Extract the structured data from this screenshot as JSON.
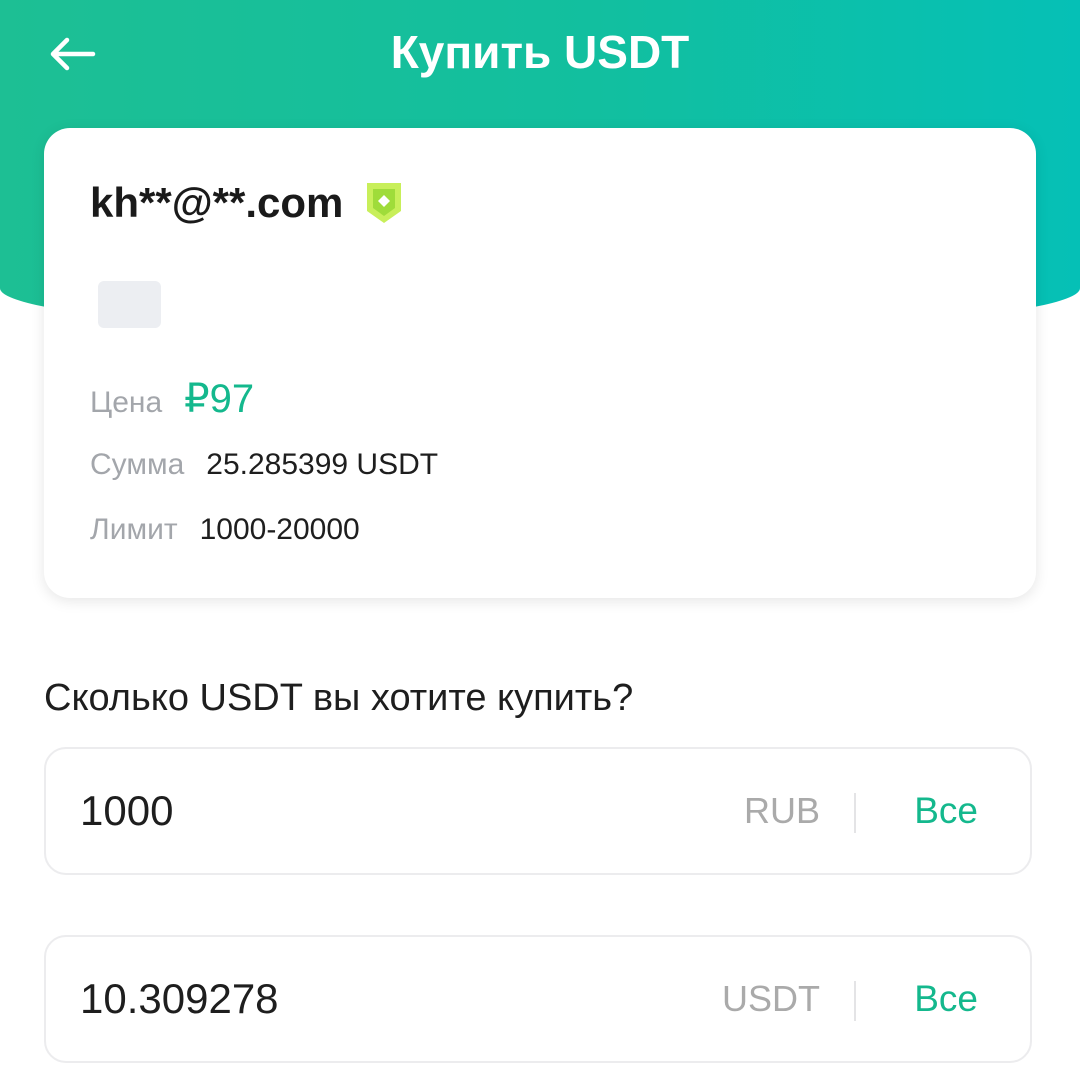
{
  "header": {
    "title": "Купить USDT",
    "back_icon": "arrow-left-icon"
  },
  "seller": {
    "name": "kh**@**.com",
    "badge_icon": "shield-verified-icon",
    "price_label": "Цена",
    "price_value": "₽97",
    "amount_label": "Сумма",
    "amount_value": "25.285399 USDT",
    "limit_label": "Лимит",
    "limit_value": "1000-20000"
  },
  "purchase": {
    "question": "Сколько USDT вы хотите купить?",
    "rub_field": {
      "value": "1000",
      "currency": "RUB",
      "all_label": "Все"
    },
    "usdt_field": {
      "value": "10.309278",
      "currency": "USDT",
      "all_label": "Все"
    }
  },
  "colors": {
    "accent": "#14b88d",
    "header_gradient_start": "#1dbf94",
    "header_gradient_end": "#05c0b6",
    "badge": "#c8ef5a"
  }
}
